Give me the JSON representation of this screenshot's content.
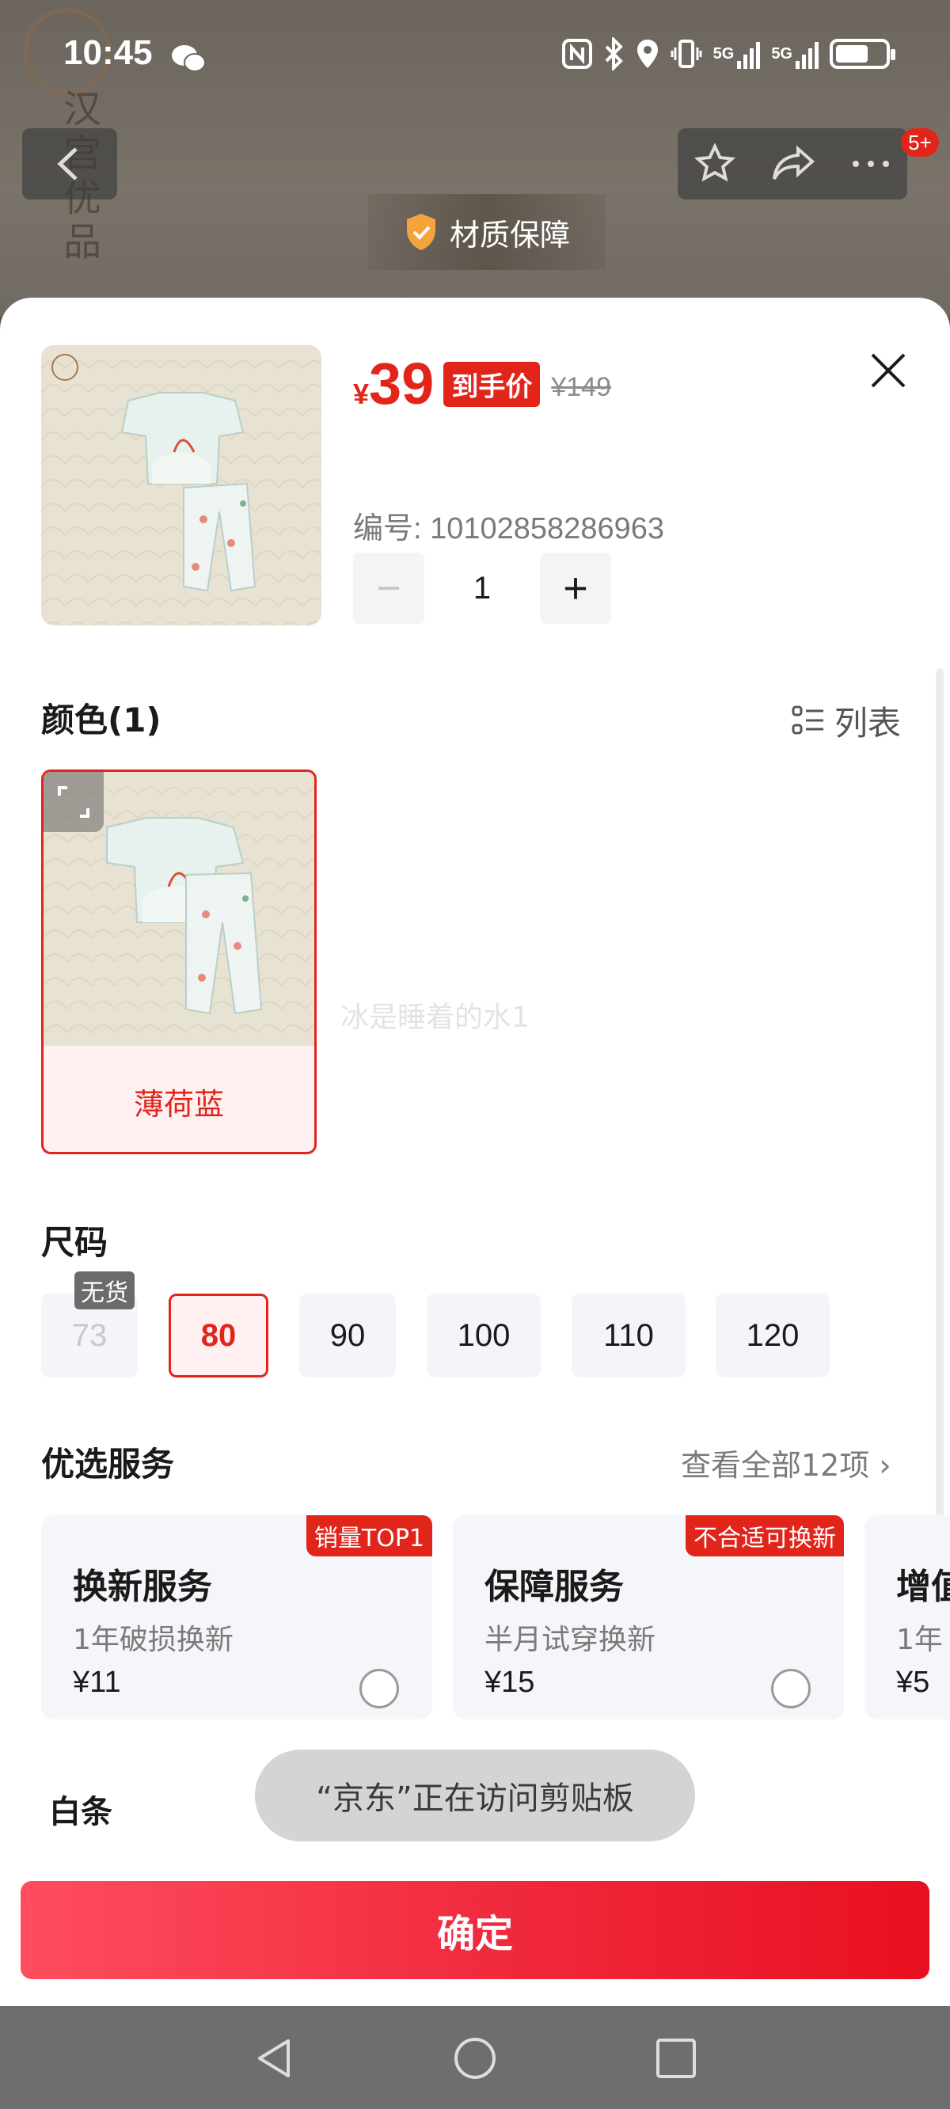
{
  "status_bar": {
    "time": "10:45",
    "network1": "5G",
    "network2": "5G"
  },
  "background": {
    "brand_chars": "汉宫优品",
    "material_badge": "材质保障",
    "notification_count": "5+"
  },
  "product": {
    "price_symbol": "¥",
    "price": "39",
    "price_tag": "到手价",
    "original_price": "¥149",
    "sku_label": "编号: 10102858286963",
    "quantity": "1",
    "minus": "−",
    "plus": "+"
  },
  "color_section": {
    "title": "颜色(1)",
    "list_toggle": "列表",
    "options": [
      {
        "label": "薄荷蓝",
        "selected": true
      }
    ],
    "watermark": "冰是睡着的水1"
  },
  "size_section": {
    "title": "尺码",
    "no_stock_label": "无货",
    "sizes": [
      {
        "label": "73",
        "state": "out_of_stock"
      },
      {
        "label": "80",
        "state": "selected"
      },
      {
        "label": "90",
        "state": "available"
      },
      {
        "label": "100",
        "state": "available"
      },
      {
        "label": "110",
        "state": "available"
      },
      {
        "label": "120",
        "state": "available"
      }
    ]
  },
  "service_section": {
    "title": "优选服务",
    "see_all": "查看全部12项 ›",
    "cards": [
      {
        "ribbon": "销量TOP1",
        "title": "换新服务",
        "desc": "1年破损换新",
        "price": "¥11"
      },
      {
        "ribbon": "不合适可换新",
        "title": "保障服务",
        "desc": "半月试穿换新",
        "price": "¥15"
      },
      {
        "ribbon": "",
        "title": "增值",
        "desc": "1年",
        "price": "¥5"
      }
    ]
  },
  "payment": {
    "baitiao": "白条"
  },
  "toast": "“京东”正在访问剪贴板",
  "confirm_button": "确定",
  "colors": {
    "accent": "#e1251b",
    "selected_bg": "#fff0f1",
    "chip_bg": "#f3f5f9"
  },
  "icons": [
    "wechat-icon",
    "nfc-icon",
    "bluetooth-icon",
    "location-icon",
    "vibrate-icon",
    "signal-icon",
    "battery-icon",
    "back-icon",
    "star-icon",
    "share-icon",
    "more-icon",
    "shield-icon",
    "close-icon",
    "list-icon",
    "expand-icon",
    "nav-back-icon",
    "nav-home-icon",
    "nav-recents-icon"
  ]
}
